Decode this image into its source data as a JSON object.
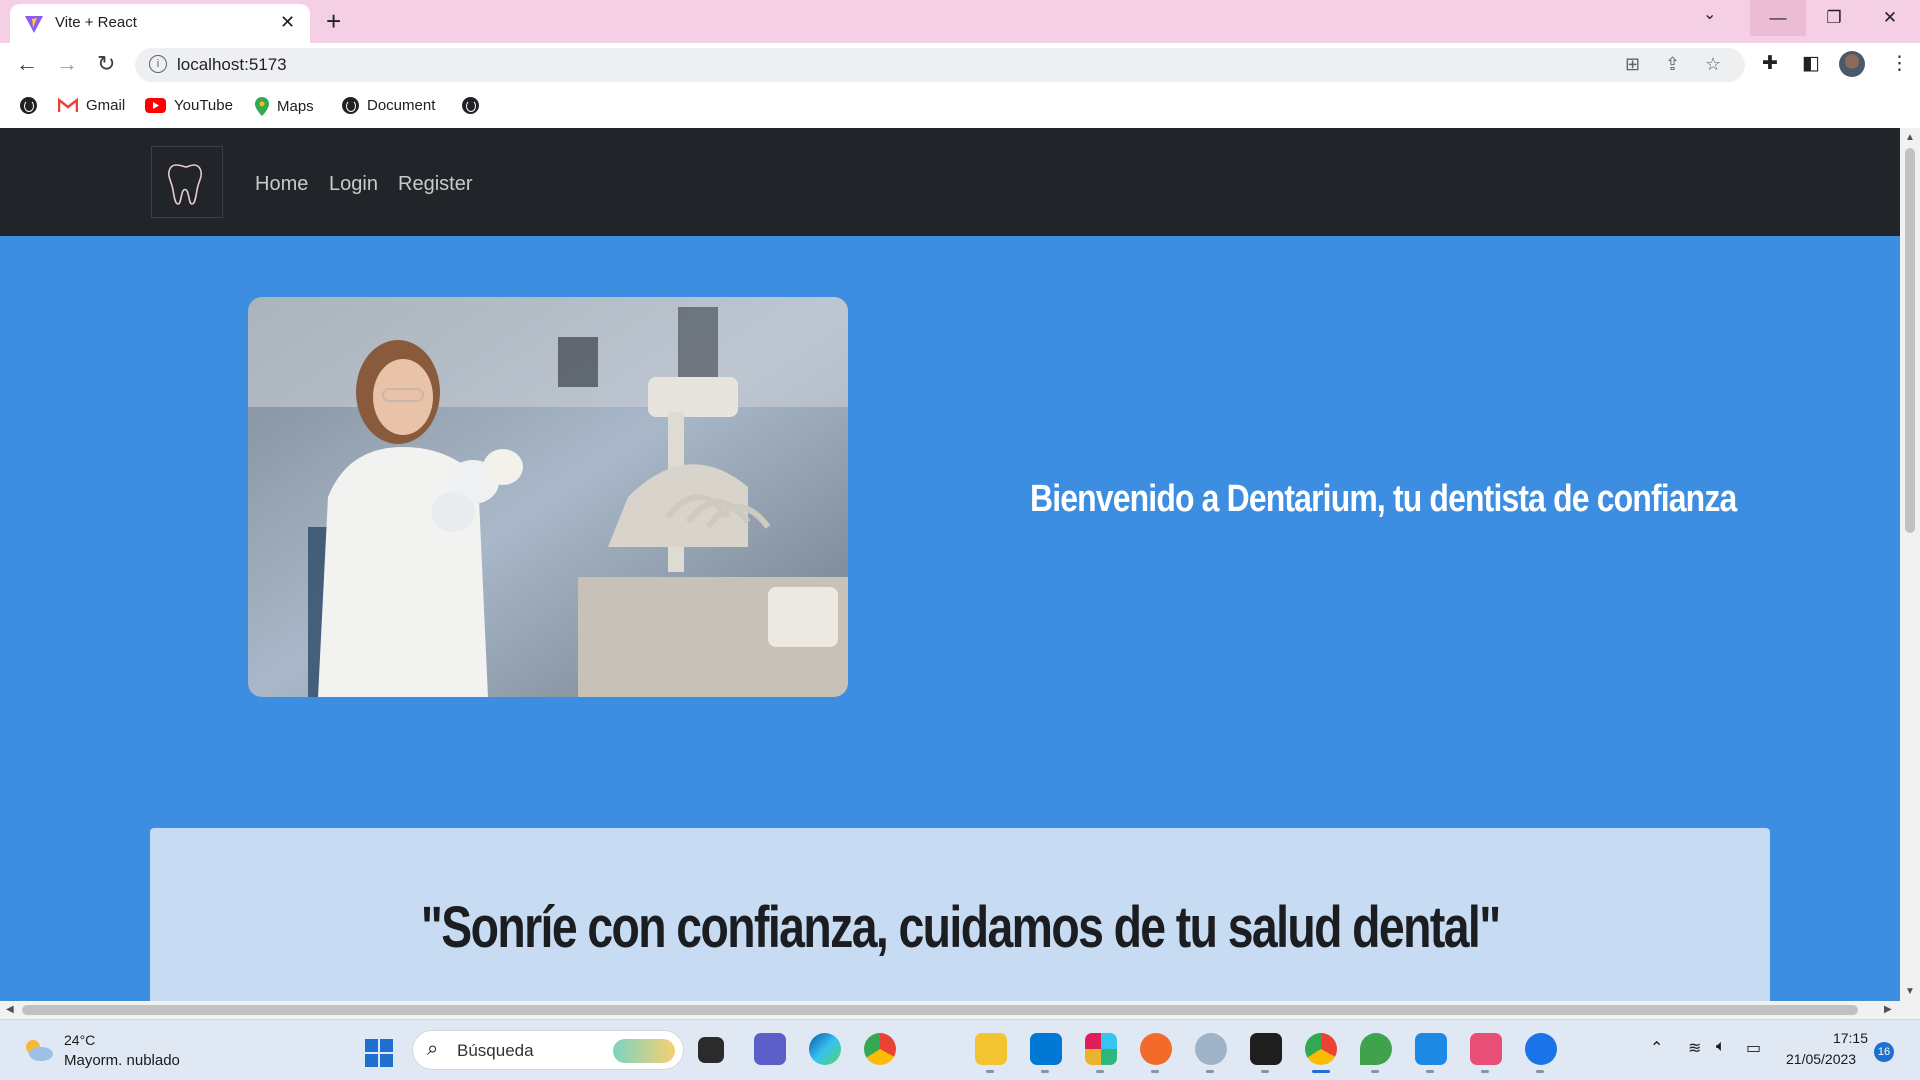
{
  "browser": {
    "tab_title": "Vite + React",
    "tab_close": "✕",
    "new_tab": "+",
    "url": "localhost:5173",
    "window": {
      "minimize": "—",
      "restore": "❐",
      "close": "✕",
      "tab_search": "⌄"
    },
    "nav": {
      "back": "←",
      "forward": "→",
      "reload": "↻"
    },
    "bookmarks": [
      "Gmail",
      "YouTube",
      "Maps",
      "Document"
    ]
  },
  "site": {
    "nav": {
      "home": "Home",
      "login": "Login",
      "register": "Register"
    },
    "hero_text": "Bienvenido a Dentarium, tu dentista de confianza",
    "quote": "\"Sonríe con confianza, cuidamos de tu salud dental\""
  },
  "taskbar": {
    "weather_temp": "24°C",
    "weather_cond": "Mayorm. nublado",
    "search_placeholder": "Búsqueda",
    "time": "17:15",
    "date": "21/05/2023",
    "notifications": "16"
  },
  "colors": {
    "tabstrip": "#f5d0e4",
    "site_nav": "#212529",
    "hero_bg": "#3d8ee0",
    "quote_card": "#c7dcf3"
  }
}
